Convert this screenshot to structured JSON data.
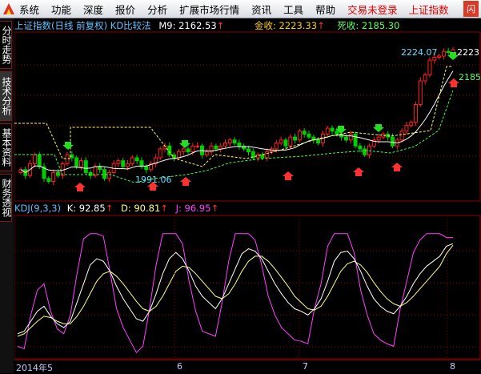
{
  "menu": {
    "items": [
      "系统",
      "功能",
      "深度",
      "报价",
      "分析",
      "扩展市场行情",
      "资讯",
      "工具",
      "帮助"
    ],
    "status_items": [
      "交易未登录",
      "上证指数"
    ],
    "close_label": "闪"
  },
  "sidebar": {
    "tabs": [
      "分时走势",
      "技术分析",
      "基本资料",
      "财务透视"
    ]
  },
  "main_chart": {
    "title": "上证指数(日线 前复权) KD比较法",
    "m9_label": "M9: 2162.53",
    "jinshou_label": "金收: 2223.33",
    "sishou_label": "死收: 2185.30",
    "high_label": "2224.07",
    "low_label": "1991.06",
    "right_label_top": "2223",
    "right_label_mid": "2185"
  },
  "kdj_panel": {
    "name_label": "KDJ(9,3,3)",
    "k_label": "K: 92.85",
    "d_label": "D: 90.81",
    "j_label": "J: 96.95"
  },
  "date_axis": {
    "labels": [
      "2014年5",
      "6",
      "7",
      "8"
    ]
  },
  "colors": {
    "up": "#ff2020",
    "down": "#00d000",
    "k_line": "#ffffff",
    "d_line": "#ffff80",
    "j_line": "#ff40ff",
    "ma_line": "#ffffff",
    "grid": "#8a0000"
  },
  "chart_data": {
    "type": "candlestick",
    "price_range": [
      1991.06,
      2224.07
    ],
    "close_estimates": [
      2020,
      2010,
      2030,
      2045,
      2025,
      2005,
      2000,
      2015,
      2010,
      2030,
      2045,
      2040,
      2025,
      2035,
      2015,
      2010,
      2025,
      2020,
      2005,
      2015,
      2030,
      2035,
      2025,
      2030,
      2040,
      2035,
      2025,
      2020,
      2030,
      2040,
      2055,
      2060,
      2045,
      2040,
      2050,
      2055,
      2050,
      2060,
      2060,
      2045,
      2050,
      2060,
      2055,
      2060,
      2065,
      2070,
      2065,
      2060,
      2055,
      2050,
      2040,
      2045,
      2040,
      2050,
      2055,
      2065,
      2070,
      2060,
      2075,
      2070,
      2085,
      2080,
      2075,
      2070,
      2065,
      2080,
      2090,
      2085,
      2080,
      2075,
      2070,
      2080,
      2060,
      2055,
      2045,
      2060,
      2070,
      2075,
      2080,
      2075,
      2060,
      2070,
      2085,
      2095,
      2100,
      2130,
      2170,
      2180,
      2205,
      2210,
      2212,
      2220,
      2218,
      2223
    ],
    "kdj": {
      "k": [
        20,
        22,
        30,
        38,
        42,
        34,
        28,
        25,
        30,
        45,
        60,
        75,
        80,
        78,
        70,
        58,
        48,
        40,
        32,
        30,
        38,
        52,
        68,
        80,
        85,
        80,
        70,
        58,
        50,
        45,
        40,
        48,
        60,
        72,
        84,
        88,
        86,
        80,
        70,
        60,
        52,
        45,
        40,
        38,
        35,
        40,
        48,
        62,
        78,
        85,
        86,
        80,
        70,
        58,
        48,
        42,
        38,
        36,
        42,
        50,
        60,
        68,
        74,
        78,
        82,
        90,
        92
      ],
      "d": [
        18,
        20,
        25,
        30,
        34,
        33,
        30,
        28,
        28,
        34,
        42,
        52,
        62,
        68,
        70,
        66,
        60,
        53,
        46,
        40,
        38,
        42,
        50,
        60,
        70,
        74,
        73,
        68,
        62,
        56,
        50,
        48,
        52,
        60,
        70,
        78,
        82,
        82,
        78,
        72,
        65,
        58,
        50,
        45,
        40,
        39,
        42,
        50,
        60,
        70,
        76,
        78,
        75,
        69,
        61,
        54,
        48,
        44,
        42,
        45,
        50,
        56,
        62,
        68,
        74,
        84,
        90.81
      ],
      "j": [
        10,
        8,
        35,
        55,
        60,
        38,
        24,
        20,
        35,
        68,
        96,
        100,
        100,
        98,
        70,
        40,
        25,
        15,
        5,
        10,
        40,
        75,
        100,
        100,
        100,
        92,
        62,
        38,
        22,
        20,
        18,
        45,
        78,
        100,
        100,
        100,
        95,
        75,
        50,
        35,
        25,
        20,
        15,
        14,
        12,
        40,
        60,
        90,
        100,
        100,
        100,
        85,
        55,
        35,
        20,
        15,
        12,
        10,
        40,
        62,
        85,
        95,
        100,
        100,
        100,
        96.95,
        96.95
      ]
    }
  }
}
